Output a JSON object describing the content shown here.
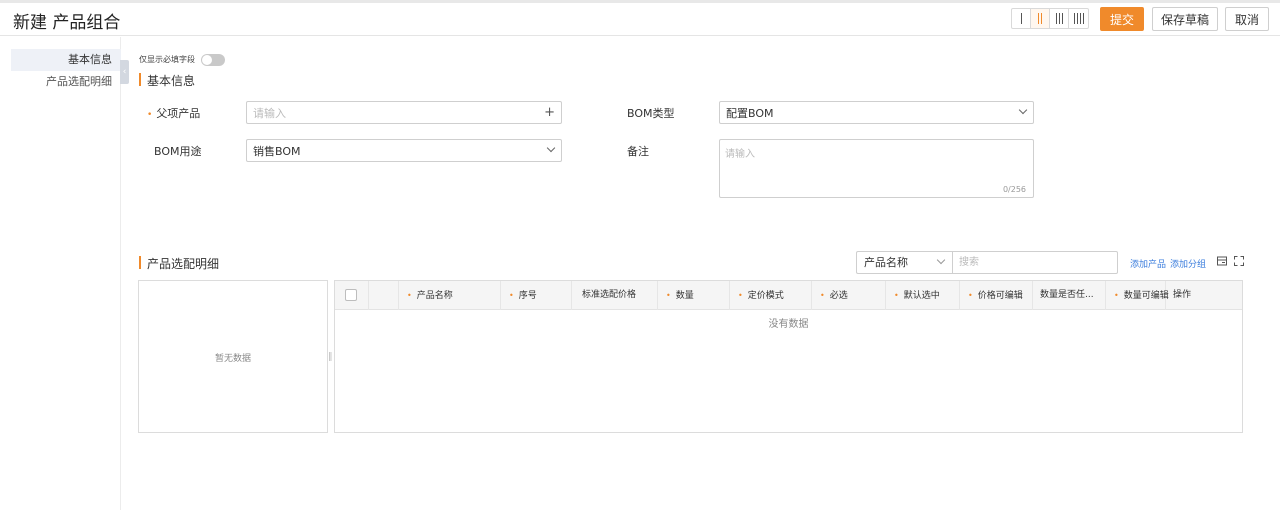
{
  "header": {
    "title": "新建 产品组合",
    "submit_label": "提交",
    "save_draft_label": "保存草稿",
    "cancel_label": "取消",
    "accent_color": "#f08a2b"
  },
  "sidenav": {
    "items": [
      {
        "label": "基本信息",
        "active": true
      },
      {
        "label": "产品选配明细",
        "active": false
      }
    ]
  },
  "required_toggle_label": "仅显示必填字段",
  "basic_section": {
    "title": "基本信息",
    "parent_product": {
      "label": "父项产品",
      "placeholder": "请输入",
      "required": true
    },
    "bom_type": {
      "label": "BOM类型",
      "value": "配置BOM"
    },
    "bom_usage": {
      "label": "BOM用途",
      "value": "销售BOM"
    },
    "remark": {
      "label": "备注",
      "placeholder": "请输入",
      "counter": "0/256"
    }
  },
  "detail_section": {
    "title": "产品选配明细",
    "search_field_select": "产品名称",
    "search_placeholder": "搜索",
    "add_product_label": "添加产品",
    "add_group_label": "添加分组",
    "group_panel_empty": "暂无数据",
    "table_columns": [
      {
        "label": "产品名称",
        "required": true
      },
      {
        "label": "序号",
        "required": true
      },
      {
        "label": "标准选配价格",
        "required": false
      },
      {
        "label": "数量",
        "required": true
      },
      {
        "label": "定价模式",
        "required": true
      },
      {
        "label": "必选",
        "required": true
      },
      {
        "label": "默认选中",
        "required": true
      },
      {
        "label": "价格可编辑",
        "required": true
      },
      {
        "label": "数量是否任...",
        "required": false
      },
      {
        "label": "数量可编辑",
        "required": true
      },
      {
        "label": "操作",
        "required": false
      }
    ],
    "table_empty": "没有数据"
  }
}
